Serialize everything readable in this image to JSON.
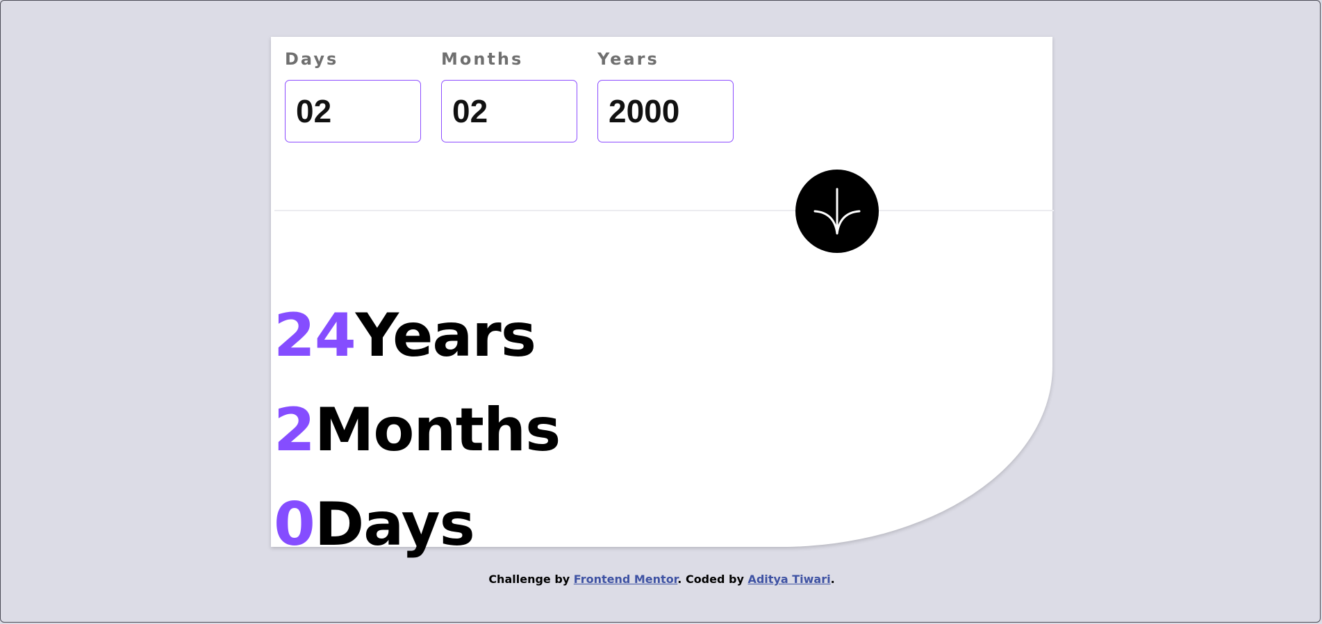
{
  "form": {
    "day": {
      "label": "Days",
      "value": "02"
    },
    "month": {
      "label": "Months",
      "value": "02"
    },
    "year": {
      "label": "Years",
      "value": "2000"
    }
  },
  "submit_icon": "arrow-down-icon",
  "results": {
    "years": {
      "value": "24",
      "unit": "Years"
    },
    "months": {
      "value": "2",
      "unit": "Months"
    },
    "days": {
      "value": "0",
      "unit": "Days"
    }
  },
  "footer": {
    "prefix": "Challenge by ",
    "link1": "Frontend Mentor",
    "middle": ". Coded by ",
    "link2": "Aditya Tiwari",
    "suffix": "."
  },
  "colors": {
    "accent": "#854dff",
    "background": "#dcdce6",
    "card": "#ffffff",
    "link": "#3e52a3"
  }
}
